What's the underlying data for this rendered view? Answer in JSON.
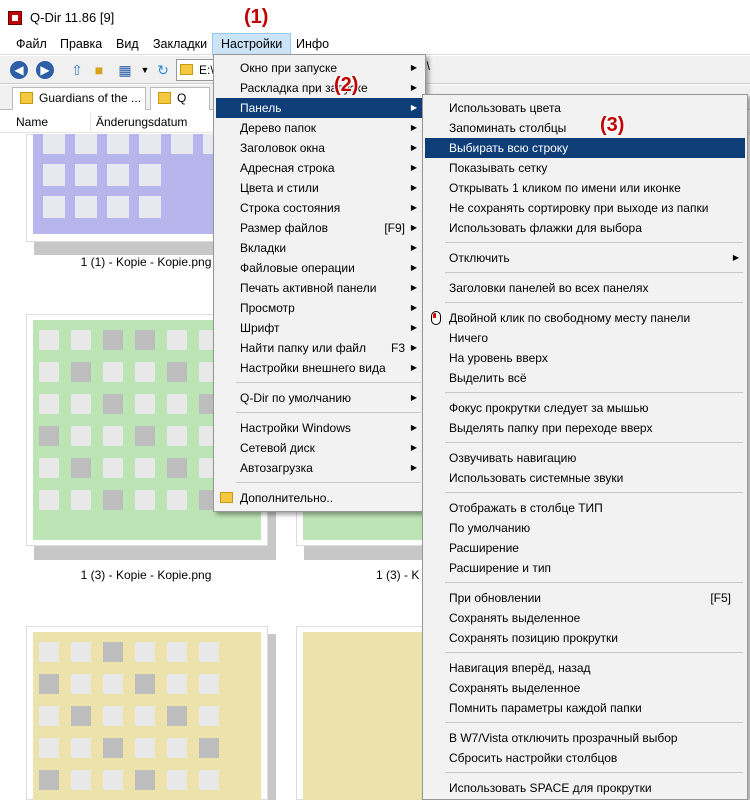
{
  "window": {
    "title": "Q-Dir 11.86 [9]"
  },
  "menubar": [
    "Файл",
    "Правка",
    "Вид",
    "Закладки",
    "Настройки",
    "Инфо"
  ],
  "toolbar": {
    "address_left": "E:\\",
    "address_right": "2\\"
  },
  "tabs": [
    "Guardians of the ...",
    "Q"
  ],
  "columns": [
    "Name",
    "Änderungsdatum"
  ],
  "files": [
    "1 (1) - Kopie - Kopie.png",
    "1 (3) - Kopie - Kopie.png",
    "1 (3) - K"
  ],
  "steps": [
    "(1)",
    "(2)",
    "(3)"
  ],
  "settings_menu": {
    "items": [
      {
        "label": "Окно при запуске",
        "arrow": "▶"
      },
      {
        "label": "Раскладка при запуске",
        "arrow": "▶"
      },
      {
        "label": "Панель",
        "arrow": "▶"
      },
      {
        "label": "Дерево папок",
        "arrow": "▶"
      },
      {
        "label": "Заголовок окна",
        "arrow": "▶"
      },
      {
        "label": "Адресная строка",
        "arrow": "▶"
      },
      {
        "label": "Цвета и стили",
        "arrow": "▶"
      },
      {
        "label": "Строка состояния",
        "arrow": "▶"
      },
      {
        "label": "Размер файлов",
        "shortcut": "[F9]",
        "arrow": "▶"
      },
      {
        "label": "Вкладки",
        "arrow": "▶"
      },
      {
        "label": "Файловые операции",
        "arrow": "▶"
      },
      {
        "label": "Печать активной панели",
        "arrow": "▶"
      },
      {
        "label": "Просмотр",
        "arrow": "▶"
      },
      {
        "label": "Шрифт",
        "arrow": "▶"
      },
      {
        "label": "Найти папку или файл",
        "shortcut": "F3",
        "arrow": "▶"
      },
      {
        "label": "Настройки внешнего вида",
        "arrow": "▶"
      },
      {
        "label": "Q-Dir по умолчанию",
        "arrow": "▶"
      },
      {
        "label": "Настройки Windows",
        "arrow": "▶"
      },
      {
        "label": "Сетевой диск",
        "arrow": "▶"
      },
      {
        "label": "Автозагрузка",
        "arrow": "▶"
      },
      {
        "label": "Дополнительно.."
      }
    ]
  },
  "panel_menu": {
    "items": [
      {
        "label": "Использовать цвета"
      },
      {
        "label": "Запоминать столбцы"
      },
      {
        "label": "Выбирать всю строку"
      },
      {
        "label": "Показывать сетку"
      },
      {
        "label": "Открывать 1 кликом по имени или иконке"
      },
      {
        "label": "Не сохранять сортировку при выходе из папки"
      },
      {
        "label": "Использовать флажки для выбора"
      },
      {
        "label": "Отключить",
        "arrow": "▶"
      },
      {
        "label": "Заголовки панелей во всех панелях"
      },
      {
        "label": "Двойной клик по свободному месту панели"
      },
      {
        "label": "Ничего"
      },
      {
        "label": "На уровень вверх"
      },
      {
        "label": "Выделить всё"
      },
      {
        "label": "Фокус прокрутки следует за мышью"
      },
      {
        "label": "Выделять папку при переходе вверх"
      },
      {
        "label": "Озвучивать навигацию"
      },
      {
        "label": "Использовать системные звуки"
      },
      {
        "label": "Отображать в столбце ТИП"
      },
      {
        "label": "По умолчанию"
      },
      {
        "label": "Расширение"
      },
      {
        "label": "Расширение и тип"
      },
      {
        "label": "При обновлении",
        "shortcut": "[F5]"
      },
      {
        "label": "Сохранять выделенное"
      },
      {
        "label": "Сохранять позицию прокрутки"
      },
      {
        "label": "Навигация вперёд, назад"
      },
      {
        "label": "Сохранять выделенное"
      },
      {
        "label": "Помнить параметры каждой папки"
      },
      {
        "label": "В W7/Vista отключить прозрачный выбор"
      },
      {
        "label": "Сбросить настройки столбцов"
      },
      {
        "label": "Использовать SPACE для прокрутки"
      }
    ]
  }
}
